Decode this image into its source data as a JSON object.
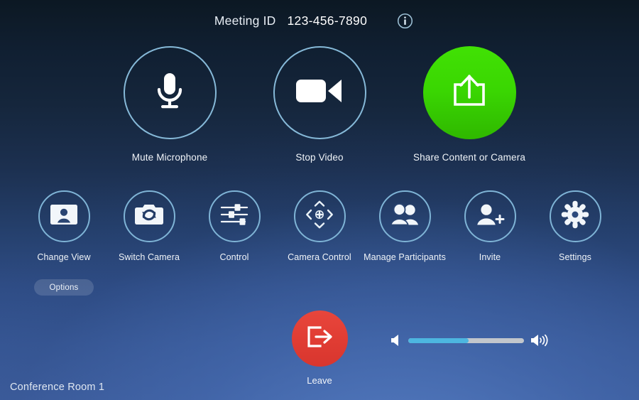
{
  "header": {
    "meeting_id_label": "Meeting ID",
    "meeting_id_value": "123-456-7890",
    "info_icon": "info-circle-icon"
  },
  "primary_controls": [
    {
      "label": "Mute Microphone",
      "icon": "microphone-icon",
      "style": "outline"
    },
    {
      "label": "Stop Video",
      "icon": "video-camera-icon",
      "style": "outline"
    },
    {
      "label": "Share Content or Camera",
      "icon": "share-upload-icon",
      "style": "green"
    }
  ],
  "secondary_controls": [
    {
      "label": "Change View",
      "icon": "person-card-icon"
    },
    {
      "label": "Switch Camera",
      "icon": "camera-switch-icon"
    },
    {
      "label": "Control",
      "icon": "sliders-icon"
    },
    {
      "label": "Camera Control",
      "icon": "camera-pan-tilt-icon"
    },
    {
      "label": "Manage Participants",
      "icon": "two-people-icon"
    },
    {
      "label": "Invite",
      "icon": "person-plus-icon"
    },
    {
      "label": "Settings",
      "icon": "gear-icon"
    }
  ],
  "options": {
    "label": "Options"
  },
  "leave": {
    "label": "Leave",
    "icon": "exit-door-arrow-icon"
  },
  "volume": {
    "level_percent": 52,
    "low_icon": "speaker-mute-icon",
    "high_icon": "speaker-loud-icon"
  },
  "footer": {
    "room_name": "Conference Room 1"
  },
  "colors": {
    "share_green": "#3ad602",
    "leave_red": "#e03c33",
    "circle_outline": "#86b9d8",
    "volume_fill": "#4db6e0",
    "background_top": "#0c1823",
    "background_bottom": "#3d5d9d"
  }
}
